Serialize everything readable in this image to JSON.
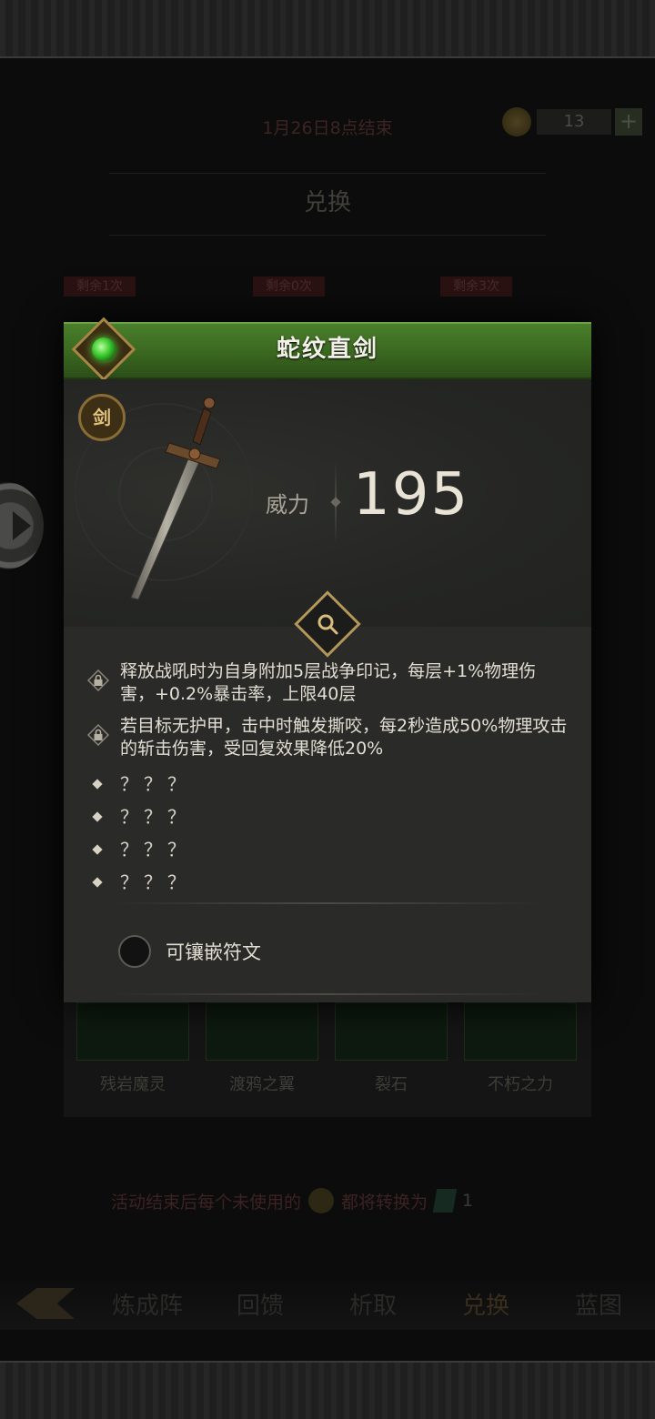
{
  "background": {
    "event_end": "1月26日8点结束",
    "currency_amount": "13",
    "currency_plus": "+",
    "exchange_title": "兑换",
    "remaining_tags": [
      "剩余1次",
      "剩余0次",
      "剩余3次"
    ],
    "cards": [
      {
        "label": "残岩魔灵"
      },
      {
        "label": "渡鸦之翼"
      },
      {
        "label": "裂石"
      },
      {
        "label": "不朽之力"
      }
    ],
    "convert_note_before": "活动结束后每个未使用的",
    "convert_note_after": "都将转换为",
    "convert_count": "1",
    "nav_tabs": [
      "炼成阵",
      "回馈",
      "析取",
      "兑换",
      "蓝图"
    ],
    "active_tab": "兑换"
  },
  "modal": {
    "title": "蛇纹直剑",
    "type_badge": "剑",
    "power_label": "威力",
    "power_value": "195",
    "affixes": [
      "释放战吼时为自身附加5层战争印记，每层+1%物理伤害，+0.2%暴击率，上限40层",
      "若目标无护甲，击中时触发撕咬，每2秒造成50%物理攻击的斩击伤害，受回复效果降低20%"
    ],
    "hidden_affixes": [
      "？？？",
      "？？？",
      "？？？",
      "？？？"
    ],
    "socket_label": "可镶嵌符文"
  },
  "colors": {
    "header_green": "#3a6720",
    "gem_green": "#3ac62d",
    "gold_border": "#b2965a",
    "panel_bg": "#2a2a29"
  },
  "icons": [
    "gem-emblem-icon",
    "sword-icon",
    "magnify-icon",
    "lock-icon",
    "diamond-bullet-icon",
    "socket-icon",
    "arrow-right-icon",
    "back-icon",
    "coin-icon",
    "plus-icon"
  ]
}
